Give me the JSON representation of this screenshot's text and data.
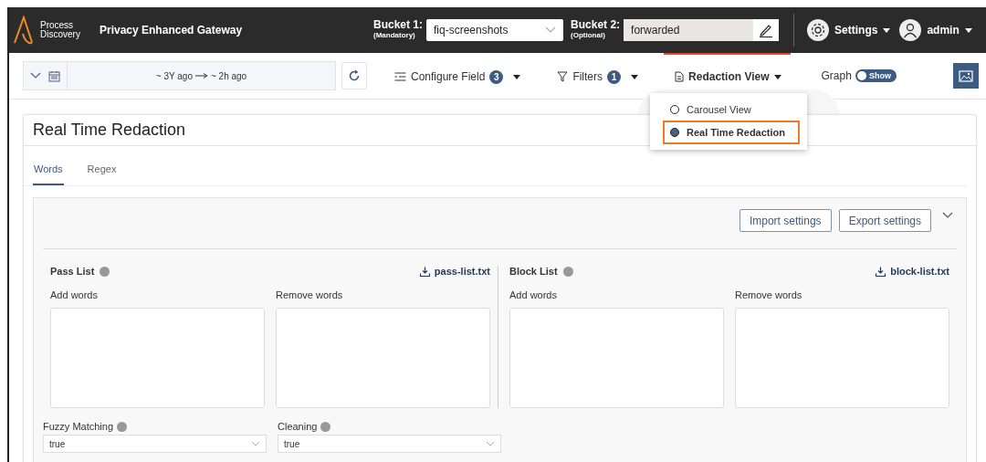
{
  "header": {
    "logo_lines": [
      "Process",
      "Discovery"
    ],
    "app_title": "Privacy Enhanced Gateway",
    "buckets": [
      {
        "label": "Bucket 1:",
        "note": "(Mandatory)",
        "value": "fiq-screenshots",
        "kind": "select"
      },
      {
        "label": "Bucket 2:",
        "note": "(Optional)",
        "value": "forwarded",
        "kind": "edit"
      }
    ],
    "settings": "Settings",
    "user": "admin"
  },
  "toolbar": {
    "time_from": "~ 3Y ago",
    "time_to": "~ 2h ago",
    "menus": [
      {
        "label": "Configure Field",
        "count": "3",
        "kind": "config",
        "active": false
      },
      {
        "label": "Filters",
        "count": "1",
        "kind": "filter",
        "active": false
      },
      {
        "label": "Redaction View",
        "kind": "doc",
        "active": true
      }
    ],
    "graph": {
      "label": "Graph",
      "toggle": "Show",
      "on": true
    }
  },
  "dropdown": {
    "options": [
      {
        "label": "Carousel View",
        "selected": false,
        "highlighted": false
      },
      {
        "label": "Real Time Redaction",
        "selected": true,
        "highlighted": true
      }
    ]
  },
  "card": {
    "title": "Real Time Redaction",
    "tabs": [
      {
        "label": "Words",
        "selected": true
      },
      {
        "label": "Regex",
        "selected": false
      }
    ],
    "buttons": [
      "Import settings",
      "Export settings"
    ],
    "lists": [
      {
        "title": "Pass List",
        "download": "pass-list.txt",
        "fields": [
          "Add words",
          "Remove words"
        ]
      },
      {
        "title": "Block List",
        "download": "block-list.txt",
        "fields": [
          "Add words",
          "Remove words"
        ]
      }
    ],
    "options": [
      {
        "label": "Fuzzy Matching",
        "value": "true"
      },
      {
        "label": "Cleaning",
        "value": "true"
      }
    ]
  }
}
